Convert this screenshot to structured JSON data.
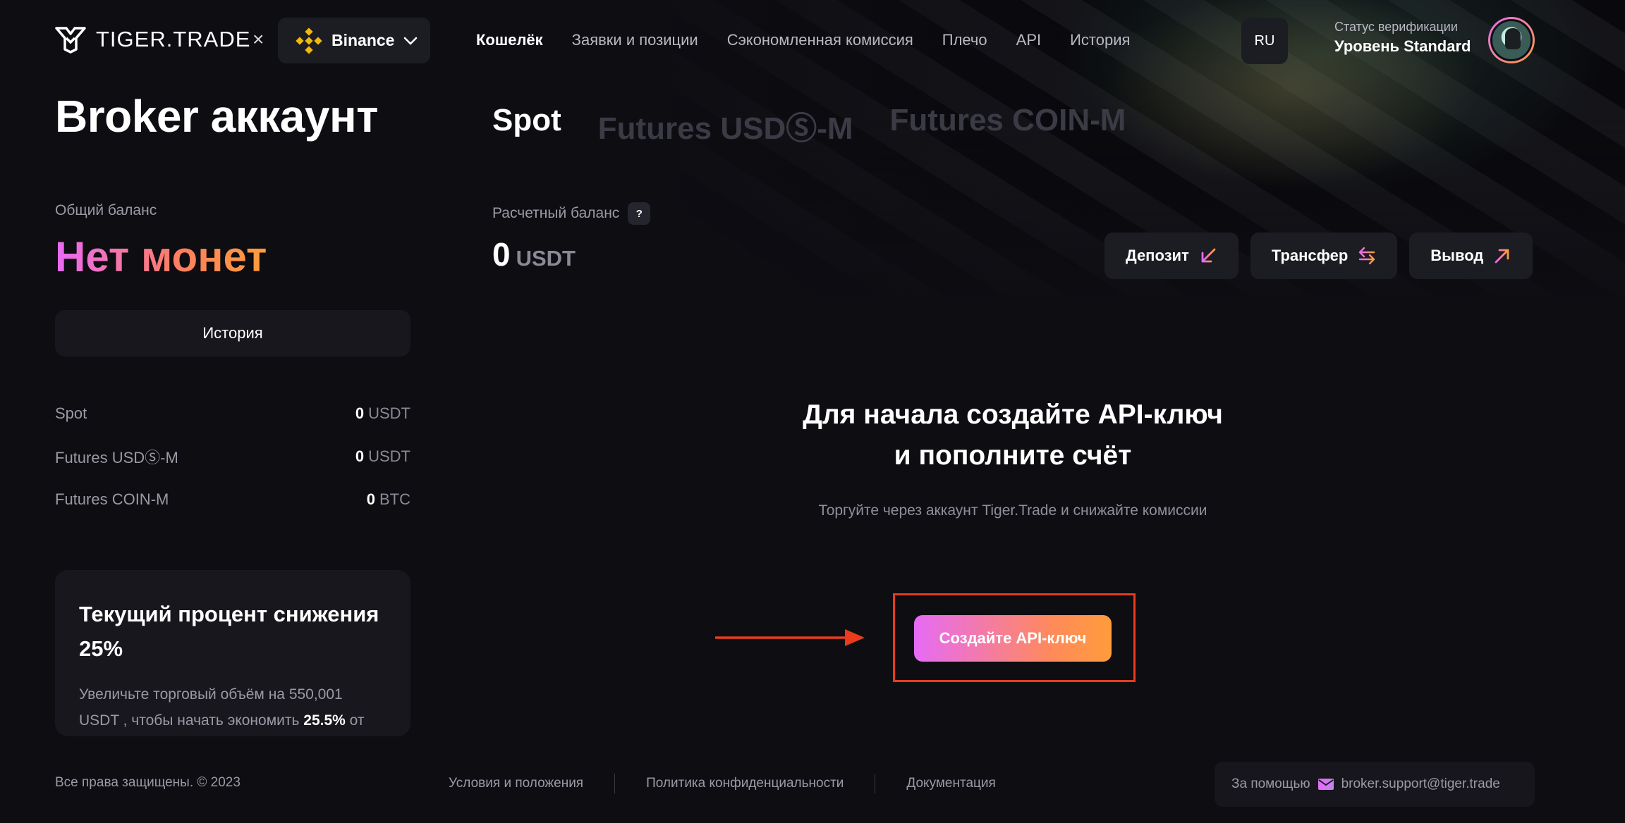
{
  "header": {
    "logo_text": "TIGER.TRADE",
    "separator": "×",
    "exchange": {
      "name": "Binance",
      "icon": "binance-logo-icon"
    },
    "nav": [
      {
        "label": "Кошелёк",
        "active": true
      },
      {
        "label": "Заявки и позиции",
        "active": false
      },
      {
        "label": "Сэкономленная комиссия",
        "active": false
      },
      {
        "label": "Плечо",
        "active": false
      },
      {
        "label": "API",
        "active": false
      },
      {
        "label": "История",
        "active": false
      }
    ],
    "language": "RU",
    "verification": {
      "label": "Статус верификации",
      "level": "Уровень Standard"
    }
  },
  "sidebar": {
    "title": "Broker аккаунт",
    "total_label": "Общий баланс",
    "total_value": "Нет монет",
    "history_button": "История",
    "balances": [
      {
        "name": "Spot",
        "value": "0",
        "unit": "USDT"
      },
      {
        "name": "Futures USDⓈ-M",
        "value": "0",
        "unit": "USDT"
      },
      {
        "name": "Futures COIN-M",
        "value": "0",
        "unit": "BTC"
      }
    ],
    "promo": {
      "title": "Текущий процент снижения 25%",
      "text_before": "Увеличьте торговый объём на 550,001 USDT , чтобы начать экономить ",
      "text_bold": "25.5%",
      "text_after": " от торговых комиссий"
    }
  },
  "main": {
    "tabs": [
      {
        "label": "Spot",
        "active": true
      },
      {
        "label": "Futures USDⓈ-M",
        "active": false
      },
      {
        "label": "Futures COIN-M",
        "active": false
      }
    ],
    "settlement_label": "Расчетный баланс",
    "help_badge": "?",
    "settlement_value": "0",
    "settlement_unit": "USDT",
    "actions": [
      {
        "label": "Депозит",
        "icon": "arrow-down-left-icon"
      },
      {
        "label": "Трансфер",
        "icon": "swap-arrows-icon"
      },
      {
        "label": "Вывод",
        "icon": "arrow-up-right-icon"
      }
    ],
    "cta": {
      "title": "Для начала создайте API-ключ и пополните счёт",
      "subtitle": "Торгуйте через аккаунт Tiger.Trade и снижайте комиссии",
      "button": "Создайте API-ключ"
    }
  },
  "footer": {
    "copyright": "Все права защищены. © 2023",
    "links": [
      "Условия и положения",
      "Политика конфиденциальности",
      "Документация"
    ],
    "support_label": "За помощью",
    "support_email": "broker.support@tiger.trade"
  },
  "colors": {
    "background": "#0d0d12",
    "accent_gradient_start": "#e66bf6",
    "accent_gradient_end": "#ff9c3c",
    "highlight": "#ea3b1c"
  }
}
